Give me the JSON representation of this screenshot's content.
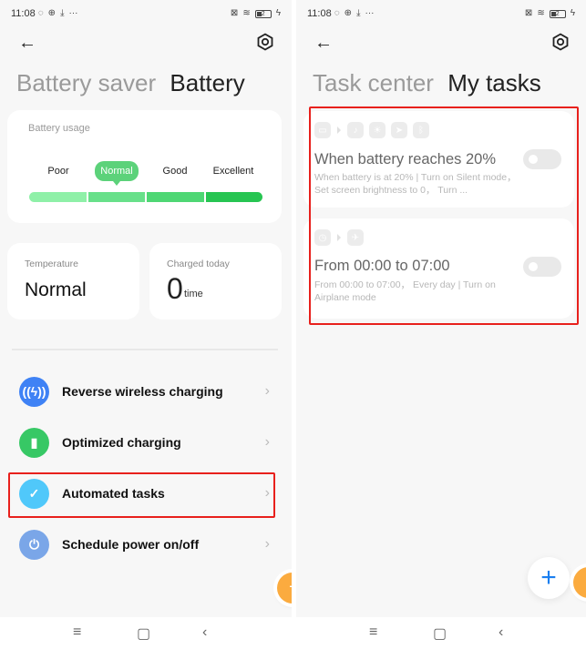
{
  "status_bar": {
    "time": "11:08",
    "left_icons": [
      "whatsapp-icon",
      "globe-icon",
      "download-icon",
      "more-dots-icon"
    ],
    "right_icons": [
      "sim-off-icon",
      "wifi-icon",
      "battery-icon",
      "charging-icon"
    ],
    "battery_level": "2"
  },
  "left_screen": {
    "header": {
      "back_icon": "arrow-left-icon",
      "settings_icon": "hex-gear-icon",
      "tab_inactive": "Battery saver",
      "tab_active": "Battery"
    },
    "battery_usage": {
      "label": "Battery usage",
      "levels": [
        "Poor",
        "Normal",
        "Good",
        "Excellent"
      ],
      "selected": "Normal",
      "bar_colors": [
        "#8ff0a8",
        "#68e08a",
        "#4ed774",
        "#27c552"
      ]
    },
    "temperature": {
      "label": "Temperature",
      "value": "Normal"
    },
    "charged_today": {
      "label": "Charged today",
      "value": "0",
      "unit": "time"
    },
    "menu": [
      {
        "label": "Reverse wireless charging",
        "icon": "wireless-charging-icon",
        "color": "#3f82f5"
      },
      {
        "label": "Optimized charging",
        "icon": "battery-shield-icon",
        "color": "#37c865"
      },
      {
        "label": "Automated tasks",
        "icon": "clipboard-check-icon",
        "color": "#50c8fa",
        "highlighted": true
      },
      {
        "label": "Schedule power on/off",
        "icon": "power-icon",
        "color": "#7aa6e8"
      }
    ],
    "chevron": "›",
    "floating_button_icon": "accessibility-icon",
    "floating_button_color": "#fbab3f"
  },
  "right_screen": {
    "header": {
      "back_icon": "arrow-left-icon",
      "settings_icon": "hex-gear-icon",
      "tab_inactive": "Task center",
      "tab_active": "My tasks"
    },
    "tasks": [
      {
        "trigger_icon": "battery-icon",
        "action_icons": [
          "silent-mode-icon",
          "brightness-icon",
          "location-icon",
          "bluetooth-icon"
        ],
        "title": "When battery reaches 20%",
        "description": "When battery is at 20% | Turn on Silent mode， Set screen brightness to 0， Turn ...",
        "enabled": false
      },
      {
        "trigger_icon": "clock-icon",
        "action_icons": [
          "airplane-icon"
        ],
        "title": "From 00:00 to 07:00",
        "description": "From 00:00 to 07:00， Every day | Turn on Airplane mode",
        "enabled": false
      }
    ],
    "add_button": "+",
    "add_button_color": "#1a7ff0"
  },
  "nav_bar": {
    "menu": "≡",
    "home": "▢",
    "back": "‹"
  },
  "highlight_color": "#e8201c"
}
